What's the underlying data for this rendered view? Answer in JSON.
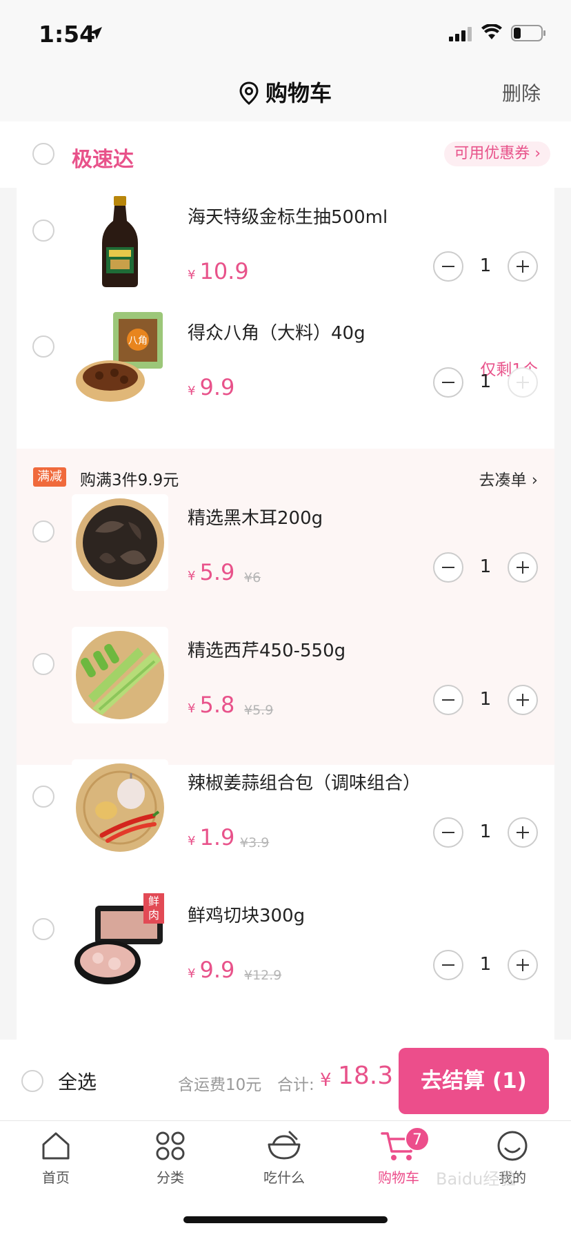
{
  "status": {
    "time": "1:54"
  },
  "nav": {
    "title": "购物车",
    "delete": "删除"
  },
  "store": {
    "name": "极速达",
    "coupon": "可用优惠券 ›"
  },
  "items": [
    {
      "name": "海天特级金标生抽500ml",
      "yen": "¥",
      "price": "10.9",
      "qty": "1"
    },
    {
      "name": "得众八角（大料）40g",
      "yen": "¥",
      "price": "9.9",
      "qty": "1",
      "stock_note": "仅剩1个"
    },
    {
      "name": "精选黑木耳200g",
      "yen": "¥",
      "price": "5.9",
      "old_price": "¥6",
      "qty": "1"
    },
    {
      "name": "精选西芹450-550g",
      "yen": "¥",
      "price": "5.8",
      "old_price": "¥5.9",
      "qty": "1"
    },
    {
      "name": "辣椒姜蒜组合包（调味组合）",
      "yen": "¥",
      "price": "1.9",
      "old_price": "¥3.9",
      "qty": "1"
    },
    {
      "name": "鲜鸡切块300g",
      "yen": "¥",
      "price": "9.9",
      "old_price": "¥12.9",
      "qty": "1",
      "thumb_tag": "鲜肉"
    }
  ],
  "promo": {
    "tag": "满减",
    "text": "购满3件9.9元",
    "link": "去凑单 ›"
  },
  "checkout": {
    "select_all": "全选",
    "shipping": "含运费10元",
    "total_label": "合计:",
    "total_yen": "¥",
    "total": "18.3",
    "button": "去结算 (1)"
  },
  "tabs": [
    {
      "label": "首页",
      "icon": "home-icon"
    },
    {
      "label": "分类",
      "icon": "grid-icon"
    },
    {
      "label": "吃什么",
      "icon": "bowl-icon"
    },
    {
      "label": "购物车",
      "icon": "cart-icon",
      "badge": "7",
      "active": true
    },
    {
      "label": "我的",
      "icon": "smile-icon"
    }
  ],
  "watermark": "Baidu经验",
  "colors": {
    "accent": "#ec4e8b",
    "promo_tag": "#f06a3c",
    "promo_bg": "#fdf6f5"
  }
}
